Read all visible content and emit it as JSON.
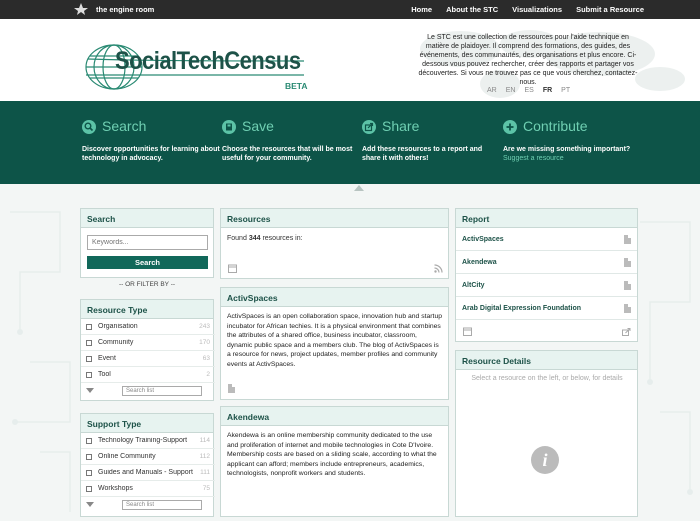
{
  "topbar": {
    "site_name": "the engine room",
    "nav": [
      "Home",
      "About the STC",
      "Visualizations",
      "Submit a Resource"
    ]
  },
  "header": {
    "logo_text": "SocialTechCensus",
    "beta": "BETA",
    "intro": "Le STC est une collection de ressources pour l'aide technique en matière de plaidoyer. Il comprend des formations, des guides, des événements, des communautés, des organisations et plus encore. Ci-dessous vous pouvez rechercher, créer des rapports et partager vos découvertes. Si vous ne trouvez pas ce que vous cherchez, contactez-nous.",
    "languages": [
      "AR",
      "EN",
      "ES",
      "FR",
      "PT"
    ],
    "active_language": "FR"
  },
  "features": [
    {
      "title": "Search",
      "icon": "search-icon",
      "desc": "Discover opportunities for learning about technology in advocacy.",
      "link": ""
    },
    {
      "title": "Save",
      "icon": "save-icon",
      "desc": "Choose the resources that will be most useful for your community.",
      "link": ""
    },
    {
      "title": "Share",
      "icon": "share-icon",
      "desc": "Add these resources to a report and share it with others!",
      "link": ""
    },
    {
      "title": "Contribute",
      "icon": "plus-icon",
      "desc": "Are we missing something important?",
      "link": "Suggest a resource"
    }
  ],
  "search": {
    "title": "Search",
    "placeholder": "Keywords...",
    "button": "Search",
    "or_filter": "-- OR FILTER BY --"
  },
  "resource_type": {
    "title": "Resource Type",
    "items": [
      {
        "label": "Organisation",
        "count": "243"
      },
      {
        "label": "Community",
        "count": "170"
      },
      {
        "label": "Event",
        "count": "63"
      },
      {
        "label": "Tool",
        "count": "2"
      }
    ],
    "search_list": "Search list"
  },
  "support_type": {
    "title": "Support Type",
    "items": [
      {
        "label": "Technology Training-Support",
        "count": "114"
      },
      {
        "label": "Online Community",
        "count": "112"
      },
      {
        "label": "Guides and Manuals - Support",
        "count": "111"
      },
      {
        "label": "Workshops",
        "count": "75"
      }
    ],
    "search_list": "Search list"
  },
  "resources": {
    "title": "Resources",
    "found_prefix": "Found",
    "found_count": "344",
    "found_suffix": "resources in:",
    "cards": [
      {
        "title": "ActivSpaces",
        "body": "ActivSpaces is an open collaboration space, innovation hub and startup incubator for African techies. It is a physical environment that combines the attributes of a shared office, business incubator, classroom, dynamic public space and a members club. The blog of ActivSpaces is a resource for news, project updates, member profiles and community events at ActivSpaces."
      },
      {
        "title": "Akendewa",
        "body": "Akendewa is an online membership community dedicated to the use and proliferation of internet and mobile technologies in Cote D'Ivoire. Membership costs are based on a sliding scale, according to what the applicant can afford; members include entrepreneurs, academics, technologists, nonprofit workers and students."
      }
    ]
  },
  "report": {
    "title": "Report",
    "items": [
      "ActivSpaces",
      "Akendewa",
      "AltCity",
      "Arab Digital Expression Foundation"
    ]
  },
  "details": {
    "title": "Resource Details",
    "hint": "Select a resource on the left, or below, for details",
    "info_glyph": "i"
  }
}
